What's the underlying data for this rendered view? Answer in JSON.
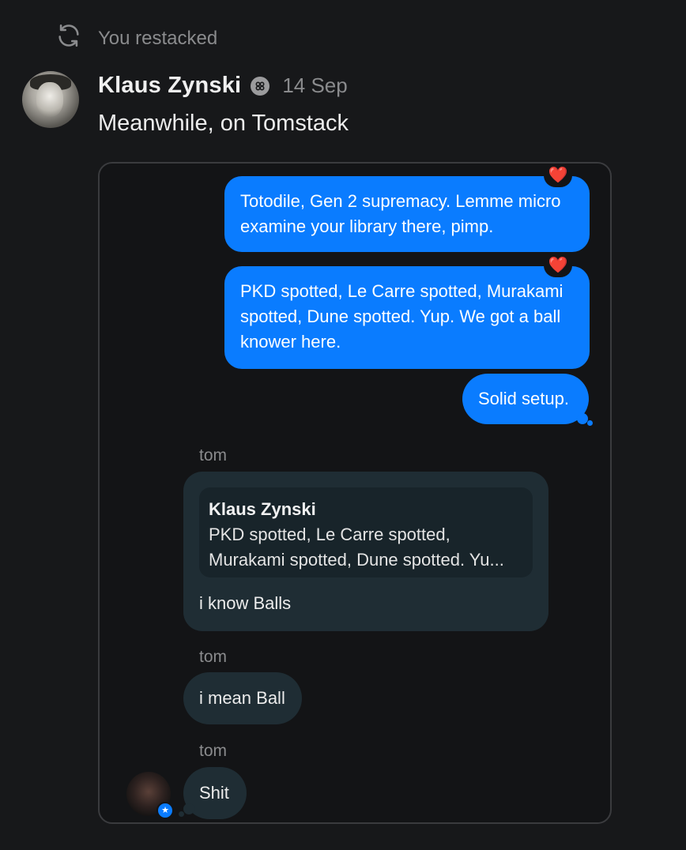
{
  "restack": {
    "label": "You restacked",
    "icon": "restack-icon"
  },
  "post": {
    "author": "Klaus Zynski",
    "date": "14 Sep",
    "text": "Meanwhile, on Tomstack"
  },
  "chat": {
    "outgoing": [
      {
        "text": "Totodile, Gen 2 supremacy. Lemme micro examine your library there, pimp.",
        "reaction": "❤️"
      },
      {
        "text": "PKD spotted, Le Carre spotted, Murakami spotted, Dune spotted. Yup. We got a ball knower here.",
        "reaction": "❤️"
      },
      {
        "text": "Solid setup."
      }
    ],
    "incoming": [
      {
        "sender": "tom",
        "quote_author": "Klaus Zynski",
        "quote_line1": "PKD spotted, Le Carre spotted,",
        "quote_line2": "Murakami spotted, Dune spotted. Yu...",
        "text": "i know Balls"
      },
      {
        "sender": "tom",
        "text": "i mean Ball"
      },
      {
        "sender": "tom",
        "text": "Shit"
      }
    ]
  },
  "colors": {
    "accent": "#0a7cff",
    "incoming_bubble": "#1f2d34",
    "background": "#17181a"
  }
}
